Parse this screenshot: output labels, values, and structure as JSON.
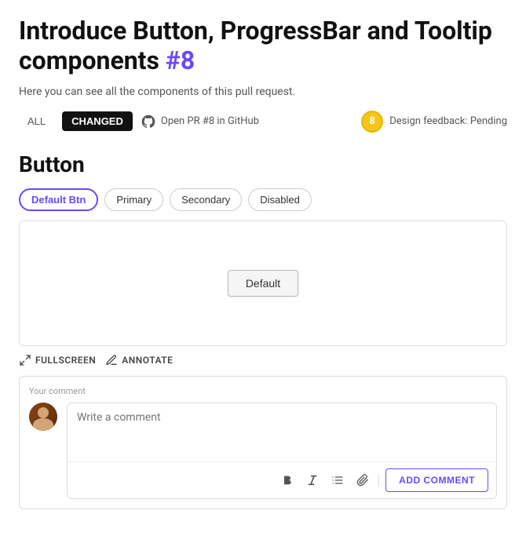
{
  "page": {
    "title_prefix": "Introduce Button, ProgressBar and Tooltip components ",
    "title_hash": "#8",
    "subtitle": "Here you can see all the components of this pull request.",
    "tab_all": "ALL",
    "tab_changed": "CHANGED",
    "github_link": "Open PR #8 in GitHub",
    "design_feedback_label": "Design feedback: Pending",
    "design_feedback_avatar": "8"
  },
  "button_section": {
    "title": "Button",
    "variants": [
      "Default Btn",
      "Primary",
      "Secondary",
      "Disabled"
    ],
    "active_variant": "Default Btn",
    "preview_button_label": "Default"
  },
  "preview_toolbar": {
    "fullscreen_label": "FULLSCREEN",
    "annotate_label": "ANNOTATE"
  },
  "comment": {
    "label": "Your comment",
    "placeholder": "Write a comment",
    "add_button": "ADD COMMENT"
  }
}
